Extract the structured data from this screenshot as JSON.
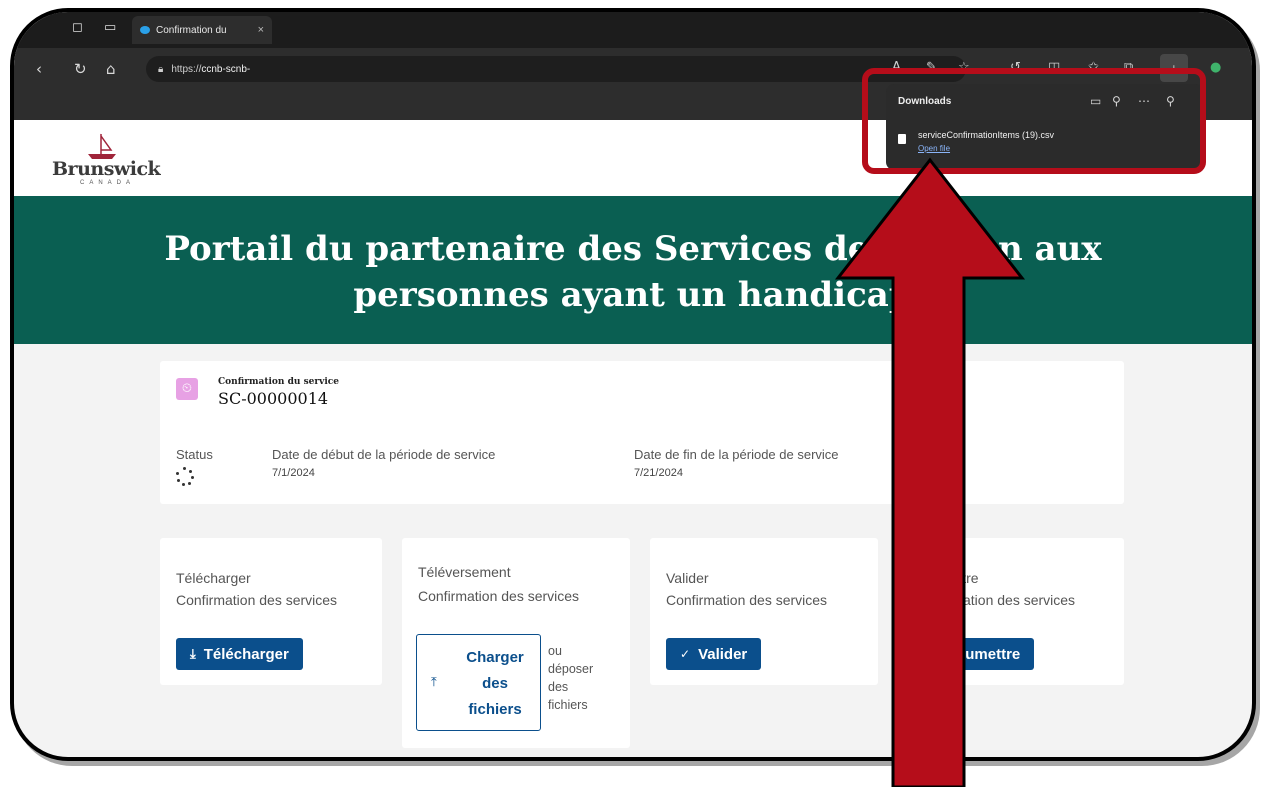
{
  "browser": {
    "tab_title": "Confirmation du",
    "tab_close": "×",
    "url_prefix": "https://",
    "url_host": "ccnb-scnb-",
    "icons": [
      "back-icon",
      "refresh-icon",
      "home-icon",
      "lock-icon",
      "read-aloud-icon",
      "favorites-star-icon",
      "split-screen-icon",
      "collections-icon",
      "downloads-icon"
    ]
  },
  "downloads_panel": {
    "title": "Downloads",
    "file_name": "serviceConfirmationItems (19).csv",
    "open_link": "Open file"
  },
  "site": {
    "logo_word": "Brunswick",
    "logo_sub": "CANADA",
    "hero_line1": "Portail du partenaire des Services de soutien aux",
    "hero_line2": "personnes ayant un handicap"
  },
  "record": {
    "type_label": "Confirmation du service",
    "id": "SC-00000014",
    "status_label": "Status",
    "start_label": "Date de début de la période de service",
    "start_value": "7/1/2024",
    "end_label": "Date de fin de la période de service",
    "end_value": "7/21/2024"
  },
  "actions": {
    "download": {
      "title": "Télécharger",
      "subtitle": "Confirmation des services",
      "button": "Télécharger"
    },
    "upload": {
      "title": "Téléversement",
      "subtitle": "Confirmation des services",
      "button_line1": "Charger",
      "button_line2": "des",
      "button_line3": "fichiers",
      "drop_text": "ou déposer des fichiers"
    },
    "validate": {
      "title": "Valider",
      "subtitle": "Confirmation des services",
      "button": "Valider"
    },
    "submit": {
      "title": "Soumettre",
      "subtitle": "Confirmation des services",
      "button": "Soumettre"
    }
  },
  "colors": {
    "hero": "#0a5f52",
    "button": "#0b4f8c",
    "annotation": "#b50d1a"
  }
}
